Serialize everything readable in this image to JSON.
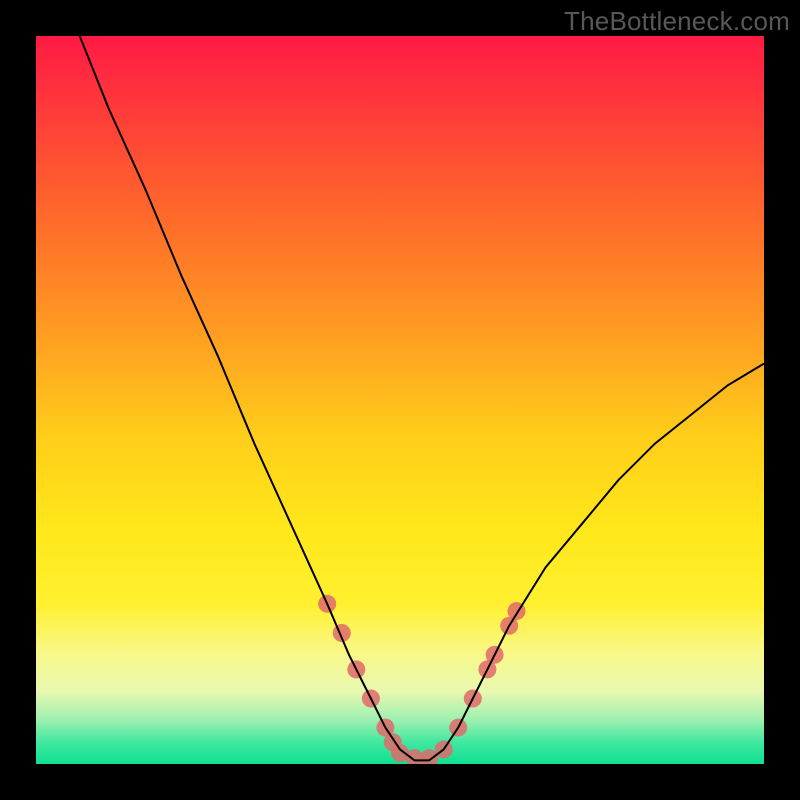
{
  "watermark": "TheBottleneck.com",
  "chart_data": {
    "type": "line",
    "title": "",
    "xlabel": "",
    "ylabel": "",
    "xlim": [
      0,
      100
    ],
    "ylim": [
      0,
      100
    ],
    "grid": false,
    "background": {
      "type": "vertical-gradient",
      "stops": [
        {
          "offset": 0.0,
          "color": "#ff1a44"
        },
        {
          "offset": 0.1,
          "color": "#ff3a3a"
        },
        {
          "offset": 0.25,
          "color": "#ff6a2a"
        },
        {
          "offset": 0.4,
          "color": "#ff9a22"
        },
        {
          "offset": 0.55,
          "color": "#ffce1a"
        },
        {
          "offset": 0.68,
          "color": "#ffe81a"
        },
        {
          "offset": 0.78,
          "color": "#fff030"
        },
        {
          "offset": 0.85,
          "color": "#f8f88a"
        },
        {
          "offset": 0.9,
          "color": "#e8f8b0"
        },
        {
          "offset": 0.94,
          "color": "#9cf0b0"
        },
        {
          "offset": 0.97,
          "color": "#40e8a0"
        },
        {
          "offset": 1.0,
          "color": "#10e090"
        }
      ]
    },
    "series": [
      {
        "name": "bottleneck-curve",
        "color": "#000000",
        "x": [
          6,
          10,
          15,
          20,
          25,
          30,
          35,
          40,
          43,
          46,
          48,
          50,
          52,
          54,
          56,
          58,
          60,
          62,
          65,
          70,
          75,
          80,
          85,
          90,
          95,
          100
        ],
        "y": [
          100,
          90,
          79,
          67,
          56,
          44,
          33,
          22,
          15,
          9,
          5,
          2,
          0.5,
          0.5,
          2,
          5,
          9,
          13,
          19,
          27,
          33,
          39,
          44,
          48,
          52,
          55
        ]
      }
    ],
    "markers": {
      "name": "highlight-dots",
      "color": "#e06a6a",
      "radius_px": 9,
      "points": [
        {
          "x": 40,
          "y": 22
        },
        {
          "x": 42,
          "y": 18
        },
        {
          "x": 44,
          "y": 13
        },
        {
          "x": 46,
          "y": 9
        },
        {
          "x": 48,
          "y": 5
        },
        {
          "x": 49,
          "y": 3
        },
        {
          "x": 50,
          "y": 1.5
        },
        {
          "x": 52,
          "y": 0.8
        },
        {
          "x": 54,
          "y": 0.8
        },
        {
          "x": 56,
          "y": 2
        },
        {
          "x": 58,
          "y": 5
        },
        {
          "x": 60,
          "y": 9
        },
        {
          "x": 62,
          "y": 13
        },
        {
          "x": 63,
          "y": 15
        },
        {
          "x": 65,
          "y": 19
        },
        {
          "x": 66,
          "y": 21
        }
      ]
    }
  }
}
